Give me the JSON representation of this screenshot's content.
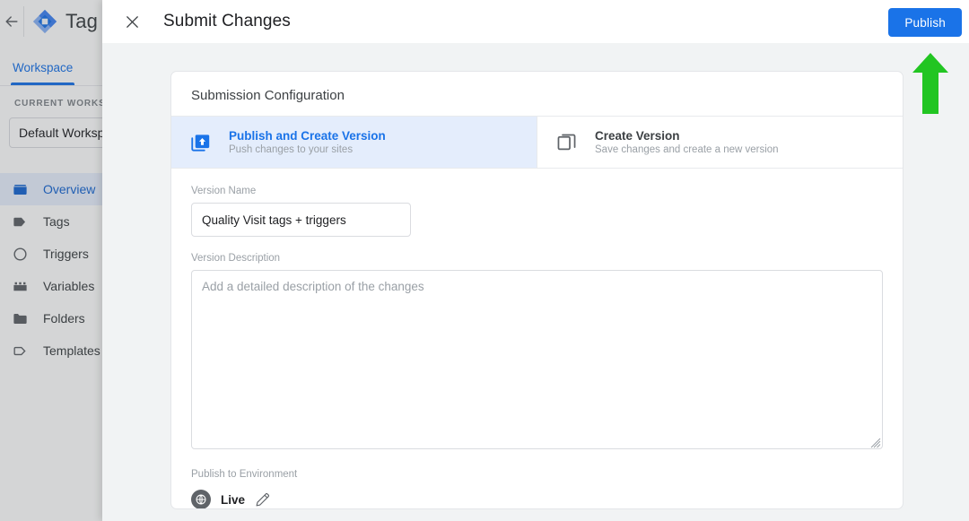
{
  "background_app": {
    "back_icon": "arrow-left-icon",
    "logo_icon": "google-tag-manager-diamond-logo",
    "product_title": "Tag",
    "tabs": [
      {
        "label": "Workspace",
        "active": true
      }
    ],
    "sidebar": {
      "section_label": "CURRENT WORKSPACE",
      "workspace_value": "Default Workspac",
      "items": [
        {
          "label": "Overview",
          "icon": "inbox-icon",
          "active": true
        },
        {
          "label": "Tags",
          "icon": "tag-icon",
          "active": false
        },
        {
          "label": "Triggers",
          "icon": "trigger-icon",
          "active": false
        },
        {
          "label": "Variables",
          "icon": "variables-icon",
          "active": false
        },
        {
          "label": "Folders",
          "icon": "folder-icon",
          "active": false
        },
        {
          "label": "Templates",
          "icon": "template-icon",
          "active": false
        }
      ]
    }
  },
  "modal": {
    "close_icon": "close-icon",
    "title": "Submit Changes",
    "publish_button": "Publish",
    "card": {
      "title": "Submission Configuration",
      "options": [
        {
          "title": "Publish and Create Version",
          "subtitle": "Push changes to your sites",
          "icon": "publish-upload-icon",
          "selected": true
        },
        {
          "title": "Create Version",
          "subtitle": "Save changes and create a new version",
          "icon": "copy-layers-icon",
          "selected": false
        }
      ],
      "version_name": {
        "label": "Version Name",
        "value": "Quality Visit tags + triggers"
      },
      "version_description": {
        "label": "Version Description",
        "value": "",
        "placeholder": "Add a detailed description of the changes"
      },
      "environment": {
        "label": "Publish to Environment",
        "name": "Live",
        "badge_icon": "globe-icon",
        "edit_icon": "pencil-edit-icon"
      }
    }
  },
  "annotation": {
    "arrow_icon": "up-arrow-annotation",
    "color": "#22c522"
  },
  "colors": {
    "accent_blue": "#1a73e8",
    "selected_option_bg": "#e4edfc",
    "modal_backdrop": "#f1f3f4",
    "annotation_green": "#22c522"
  }
}
